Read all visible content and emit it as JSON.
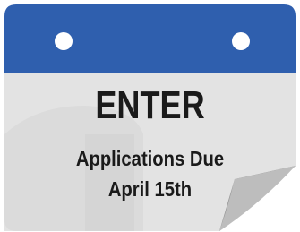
{
  "calendar": {
    "headline": "ENTER",
    "line1": "Applications Due",
    "line2": "April 15th"
  },
  "colors": {
    "header_blue": "#2f5fae",
    "page_gray": "#e3e3e3",
    "fold_gray": "#b7b7b7",
    "text": "#1a1a1a",
    "ring_white": "#ffffff"
  },
  "icons": {
    "left_ring": "binder-ring-icon",
    "right_ring": "binder-ring-icon",
    "page_curl": "page-curl-icon"
  }
}
